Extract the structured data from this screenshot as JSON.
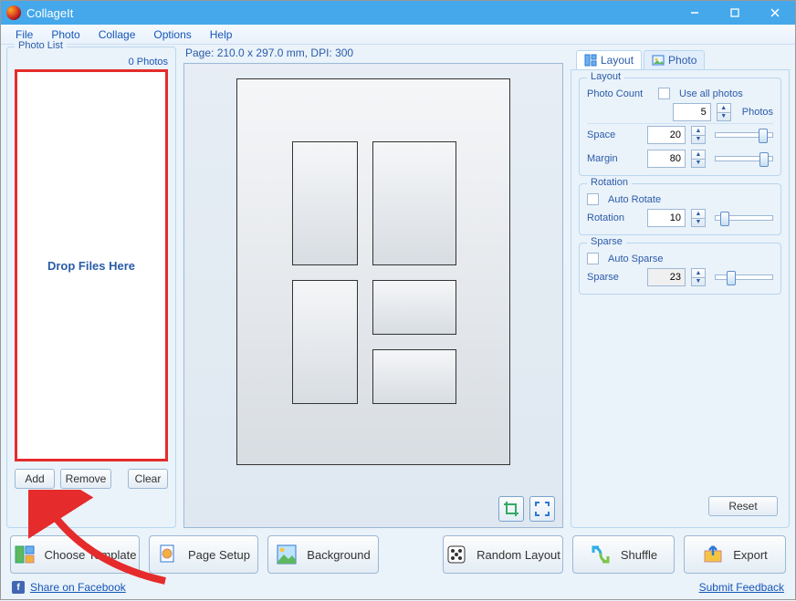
{
  "window": {
    "title": "CollageIt"
  },
  "menu": {
    "file": "File",
    "photo": "Photo",
    "collage": "Collage",
    "options": "Options",
    "help": "Help"
  },
  "left": {
    "groupTitle": "Photo List",
    "count": "0 Photos",
    "dropText": "Drop Files Here",
    "add": "Add",
    "remove": "Remove",
    "clear": "Clear"
  },
  "center": {
    "pageInfo": "Page: 210.0 x 297.0 mm, DPI: 300"
  },
  "right": {
    "tabs": {
      "layout": "Layout",
      "photo": "Photo"
    },
    "layout": {
      "title": "Layout",
      "photoCountLabel": "Photo Count",
      "useAll": "Use all photos",
      "photoCountValue": "5",
      "photosSuffix": "Photos",
      "spaceLabel": "Space",
      "spaceValue": "20",
      "marginLabel": "Margin",
      "marginValue": "80",
      "rotation": {
        "title": "Rotation",
        "auto": "Auto Rotate",
        "label": "Rotation",
        "value": "10"
      },
      "sparse": {
        "title": "Sparse",
        "auto": "Auto Sparse",
        "label": "Sparse",
        "value": "23"
      }
    },
    "reset": "Reset"
  },
  "bottom": {
    "chooseTemplate": "Choose Template",
    "pageSetup": "Page Setup",
    "background": "Background",
    "randomLayout": "Random Layout",
    "shuffle": "Shuffle",
    "export": "Export"
  },
  "footer": {
    "share": "Share on Facebook",
    "feedback": "Submit Feedback"
  }
}
